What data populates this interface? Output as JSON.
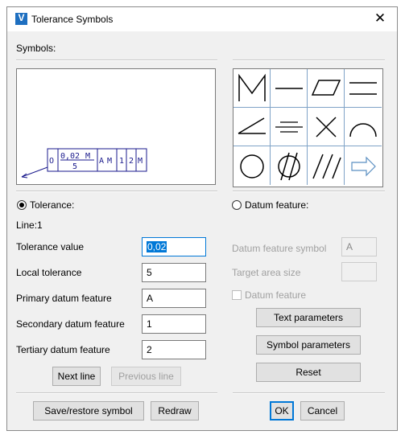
{
  "window": {
    "title": "Tolerance Symbols",
    "close_glyph": "✕",
    "icon_letter": "V"
  },
  "symbols_label": "Symbols:",
  "preview": {
    "frame_cells": [
      "0,02",
      "5",
      "A",
      "1",
      "2"
    ],
    "cell_marker": "M",
    "circle_symbol": "O"
  },
  "palette": {
    "symbols": [
      "max-material-M",
      "straightness",
      "flatness",
      "parallelism",
      "angularity",
      "symmetry",
      "perpendicular-cross",
      "profile-of-line",
      "circularity",
      "cylindricity",
      "total-runout",
      "next-arrow"
    ]
  },
  "tolerance_radio": {
    "label": "Tolerance:",
    "checked": true
  },
  "datum_radio": {
    "label": "Datum feature:",
    "checked": false
  },
  "line_info": "Line:1",
  "fields": {
    "tolerance_value": {
      "label": "Tolerance value",
      "value": "0,02"
    },
    "local_tolerance": {
      "label": "Local tolerance",
      "value": "5"
    },
    "primary_datum": {
      "label": "Primary datum feature",
      "value": "A"
    },
    "secondary_datum": {
      "label": "Secondary datum feature",
      "value": "1"
    },
    "tertiary_datum": {
      "label": "Tertiary datum feature",
      "value": "2"
    }
  },
  "datum_side": {
    "symbol_label": "Datum feature symbol",
    "symbol_value": "A",
    "target_area_label": "Target area size",
    "target_area_value": "",
    "checkbox_label": "Datum feature"
  },
  "buttons": {
    "next_line": "Next line",
    "previous_line": "Previous line",
    "text_parameters": "Text parameters",
    "symbol_parameters": "Symbol parameters",
    "reset": "Reset",
    "save_restore": "Save/restore symbol",
    "redraw": "Redraw",
    "ok": "OK",
    "cancel": "Cancel"
  }
}
